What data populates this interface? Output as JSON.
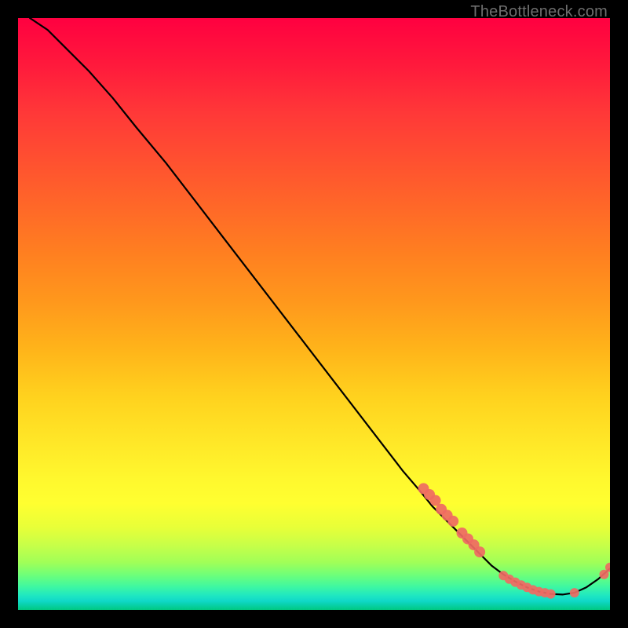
{
  "watermark": "TheBottleneck.com",
  "chart_data": {
    "type": "line",
    "title": "",
    "xlabel": "",
    "ylabel": "",
    "xlim": [
      0,
      100
    ],
    "ylim": [
      0,
      100
    ],
    "grid": false,
    "legend": false,
    "series": [
      {
        "name": "curve",
        "color": "#000000",
        "x": [
          2,
          5,
          8,
          12,
          16,
          20,
          25,
          30,
          35,
          40,
          45,
          50,
          55,
          60,
          65,
          68,
          70,
          73,
          76,
          78,
          80,
          82,
          84,
          86,
          88,
          90,
          92,
          94,
          96,
          98,
          100
        ],
        "y": [
          100,
          98,
          95,
          91,
          86.5,
          81.5,
          75.5,
          69,
          62.5,
          56,
          49.5,
          43,
          36.5,
          30,
          23.5,
          20,
          17.5,
          14.5,
          11.5,
          9.5,
          7.5,
          6,
          4.8,
          3.8,
          3.1,
          2.7,
          2.6,
          2.9,
          3.8,
          5.2,
          7
        ]
      }
    ],
    "markers": [
      {
        "name": "cluster-descending",
        "shape": "circle",
        "color": "#ef6a63",
        "radius": 7,
        "points": [
          {
            "x": 68.5,
            "y": 20.5
          },
          {
            "x": 69.5,
            "y": 19.5
          },
          {
            "x": 70.5,
            "y": 18.5
          },
          {
            "x": 71.5,
            "y": 17.0
          },
          {
            "x": 72.5,
            "y": 16.0
          },
          {
            "x": 73.5,
            "y": 15.0
          },
          {
            "x": 75.0,
            "y": 13.0
          },
          {
            "x": 76.0,
            "y": 12.0
          },
          {
            "x": 77.0,
            "y": 11.0
          },
          {
            "x": 78.0,
            "y": 9.8
          }
        ]
      },
      {
        "name": "cluster-valley",
        "shape": "circle",
        "color": "#ef6a63",
        "radius": 6,
        "points": [
          {
            "x": 82.0,
            "y": 5.8
          },
          {
            "x": 83.0,
            "y": 5.2
          },
          {
            "x": 84.0,
            "y": 4.7
          },
          {
            "x": 85.0,
            "y": 4.2
          },
          {
            "x": 86.0,
            "y": 3.8
          },
          {
            "x": 87.0,
            "y": 3.4
          },
          {
            "x": 88.0,
            "y": 3.1
          },
          {
            "x": 89.0,
            "y": 2.9
          },
          {
            "x": 90.0,
            "y": 2.7
          },
          {
            "x": 94.0,
            "y": 2.9
          }
        ]
      },
      {
        "name": "cluster-tail",
        "shape": "circle",
        "color": "#ef6a63",
        "radius": 6,
        "points": [
          {
            "x": 99.0,
            "y": 6.0
          },
          {
            "x": 100.0,
            "y": 7.2
          }
        ]
      }
    ]
  }
}
